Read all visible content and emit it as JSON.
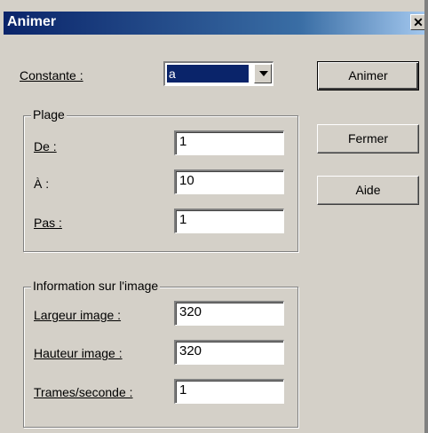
{
  "window": {
    "title": "Animer",
    "close_label": "✕"
  },
  "constante": {
    "label": "Constante :",
    "value": "a"
  },
  "plage": {
    "title": "Plage",
    "de": {
      "label": "De :",
      "value": "1"
    },
    "a": {
      "label": "À :",
      "value": "10"
    },
    "pas": {
      "label": "Pas :",
      "value": "1"
    }
  },
  "info": {
    "title": "Information sur l'image",
    "largeur": {
      "label": "Largeur image :",
      "value": "320"
    },
    "hauteur": {
      "label": "Hauteur image :",
      "value": "320"
    },
    "trames": {
      "label": "Trames/seconde :",
      "value": "1"
    }
  },
  "buttons": {
    "animer": "Animer",
    "fermer": "Fermer",
    "aide": "Aide"
  }
}
